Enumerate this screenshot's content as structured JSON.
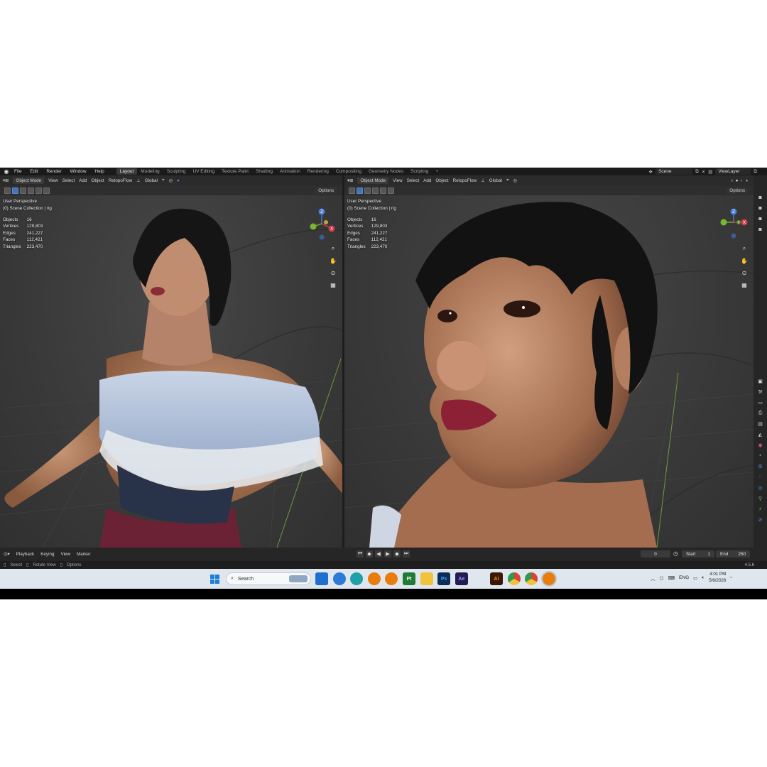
{
  "topbar": {
    "menu": [
      "File",
      "Edit",
      "Render",
      "Window",
      "Help"
    ],
    "workspaces": [
      "Layout",
      "Modeling",
      "Sculpting",
      "UV Editing",
      "Texture Paint",
      "Shading",
      "Animation",
      "Rendering",
      "Compositing",
      "Geometry Nodes",
      "Scripting"
    ],
    "active_workspace": "Layout",
    "add_workspace": "+",
    "scene": "Scene",
    "view_layer": "ViewLayer"
  },
  "viewport_header": {
    "mode": "Object Mode",
    "menus": [
      "View",
      "Select",
      "Add",
      "Object"
    ],
    "addon": "RetopoFlow",
    "orientation": "Global",
    "options": "Options"
  },
  "overlay": {
    "perspective": "User Perspective",
    "collection": "(0) Scene Collection | rig",
    "stats": [
      {
        "label": "Objects",
        "value": "16"
      },
      {
        "label": "Vertices",
        "value": "129,803"
      },
      {
        "label": "Edges",
        "value": "241,227"
      },
      {
        "label": "Faces",
        "value": "112,421"
      },
      {
        "label": "Triangles",
        "value": "223,470"
      }
    ]
  },
  "gizmo": {
    "z": "Z",
    "y": "Y",
    "x": "X"
  },
  "timeline": {
    "menus": [
      "Playback",
      "Keying",
      "View",
      "Marker"
    ],
    "current_frame": "0",
    "start_label": "Start",
    "start": "1",
    "end_label": "End",
    "end": "250"
  },
  "statusbar": {
    "hints": [
      "Select",
      "Rotate View",
      "Options"
    ],
    "version": "4.5.6"
  },
  "taskbar": {
    "search_placeholder": "Search",
    "apps": [
      {
        "name": "file-manager",
        "label": "",
        "color": "#1f6fd1"
      },
      {
        "name": "browser-1",
        "label": "",
        "color": "#2d7ad6"
      },
      {
        "name": "edge",
        "label": "",
        "color": "#1ea1a8"
      },
      {
        "name": "blender-1",
        "label": "",
        "color": "#e87d0d"
      },
      {
        "name": "blender-2",
        "label": "",
        "color": "#e87d0d"
      },
      {
        "name": "pycharm",
        "label": "Pt",
        "color": "#1f7a34"
      },
      {
        "name": "folder",
        "label": "",
        "color": "#f2c23a"
      },
      {
        "name": "photoshop",
        "label": "Ps",
        "color": "#0c2d55"
      },
      {
        "name": "after-effects",
        "label": "Ae",
        "color": "#241b52"
      },
      {
        "name": "figure-app",
        "label": "",
        "color": "#4b4b4b"
      },
      {
        "name": "illustrator",
        "label": "Ai",
        "color": "#3b1708"
      },
      {
        "name": "chrome",
        "label": "",
        "color": "#d64537"
      },
      {
        "name": "chrome-2",
        "label": "",
        "color": "#2e9b4c"
      },
      {
        "name": "blender-3",
        "label": "",
        "color": "#e87d0d"
      }
    ],
    "language": "ENG",
    "time": "4:01 PM",
    "date": "5/6/2026"
  }
}
